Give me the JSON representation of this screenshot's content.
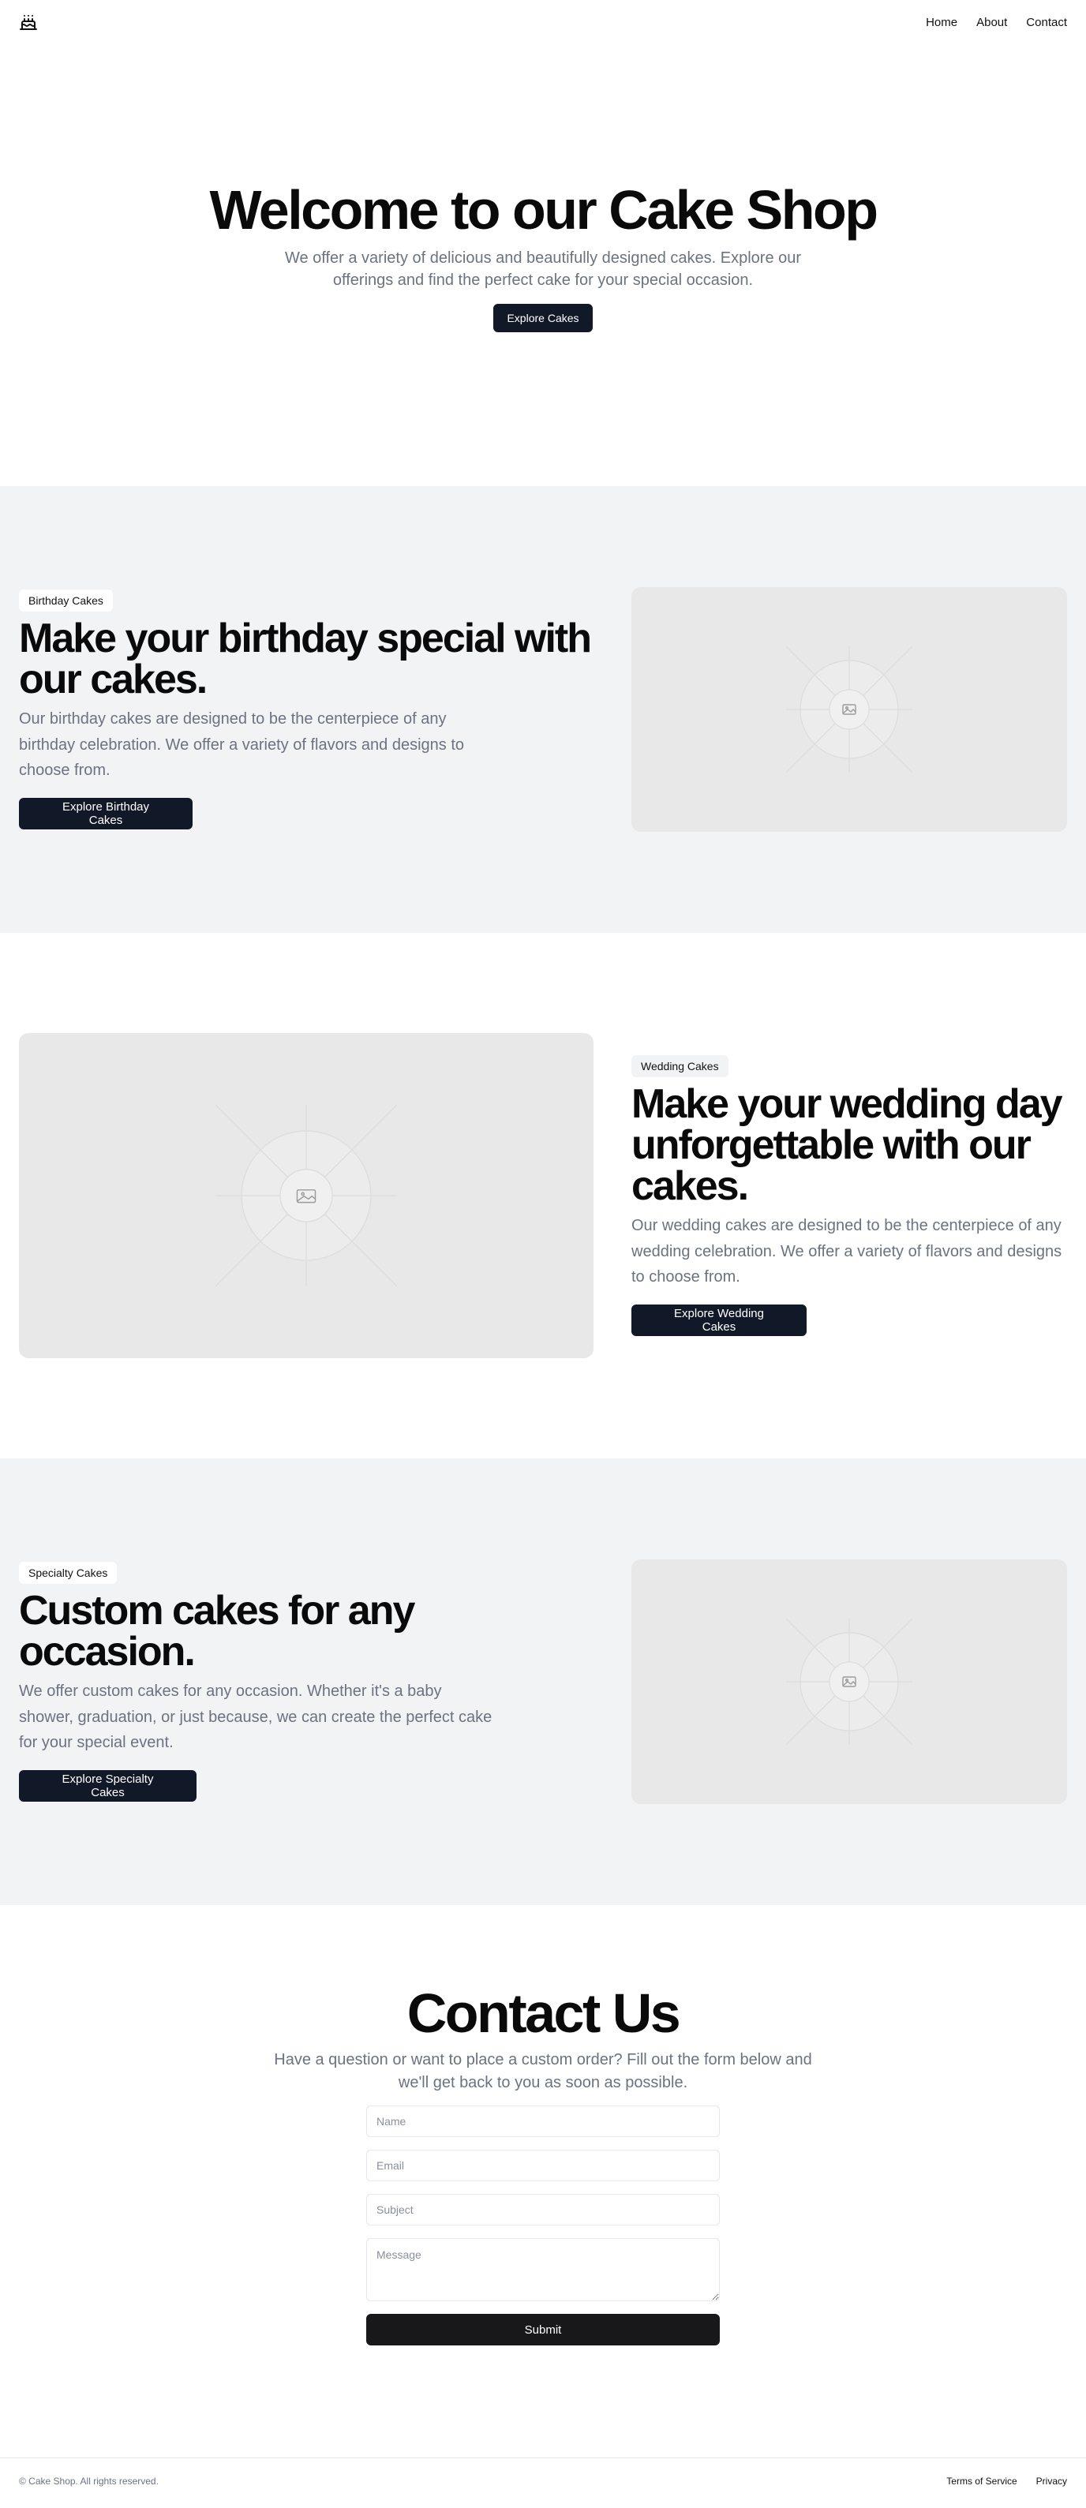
{
  "header": {
    "logo_icon": "cake-icon",
    "nav": [
      {
        "label": "Home"
      },
      {
        "label": "About"
      },
      {
        "label": "Contact"
      }
    ]
  },
  "hero": {
    "title": "Welcome to our Cake Shop",
    "description": "We offer a variety of delicious and beautifully designed cakes. Explore our offerings and find the perfect cake for your special occasion.",
    "button_label": "Explore Cakes"
  },
  "sections": [
    {
      "badge": "Birthday Cakes",
      "title": "Make your birthday special with our cakes.",
      "description": "Our birthday cakes are designed to be the centerpiece of any birthday celebration. We offer a variety of flavors and designs to choose from.",
      "button_label": "Explore Birthday Cakes",
      "image_icon": "image-placeholder-icon"
    },
    {
      "badge": "Wedding Cakes",
      "title": "Make your wedding day unforgettable with our cakes.",
      "description": "Our wedding cakes are designed to be the centerpiece of any wedding celebration. We offer a variety of flavors and designs to choose from.",
      "button_label": "Explore Wedding Cakes",
      "image_icon": "image-placeholder-icon"
    },
    {
      "badge": "Specialty Cakes",
      "title": "Custom cakes for any occasion.",
      "description": "We offer custom cakes for any occasion. Whether it's a baby shower, graduation, or just because, we can create the perfect cake for your special event.",
      "button_label": "Explore Specialty Cakes",
      "image_icon": "image-placeholder-icon"
    }
  ],
  "contact": {
    "title": "Contact Us",
    "description": "Have a question or want to place a custom order? Fill out the form below and we'll get back to you as soon as possible.",
    "fields": {
      "name_placeholder": "Name",
      "email_placeholder": "Email",
      "subject_placeholder": "Subject",
      "message_placeholder": "Message"
    },
    "submit_label": "Submit"
  },
  "footer": {
    "copyright": "© Cake Shop. All rights reserved.",
    "links": [
      {
        "label": "Terms of Service"
      },
      {
        "label": "Privacy"
      }
    ]
  },
  "colors": {
    "primary_button": "#111827",
    "section_gray": "#f2f3f5",
    "muted_text": "#6b7280",
    "placeholder_bg": "#e8e8e8"
  }
}
